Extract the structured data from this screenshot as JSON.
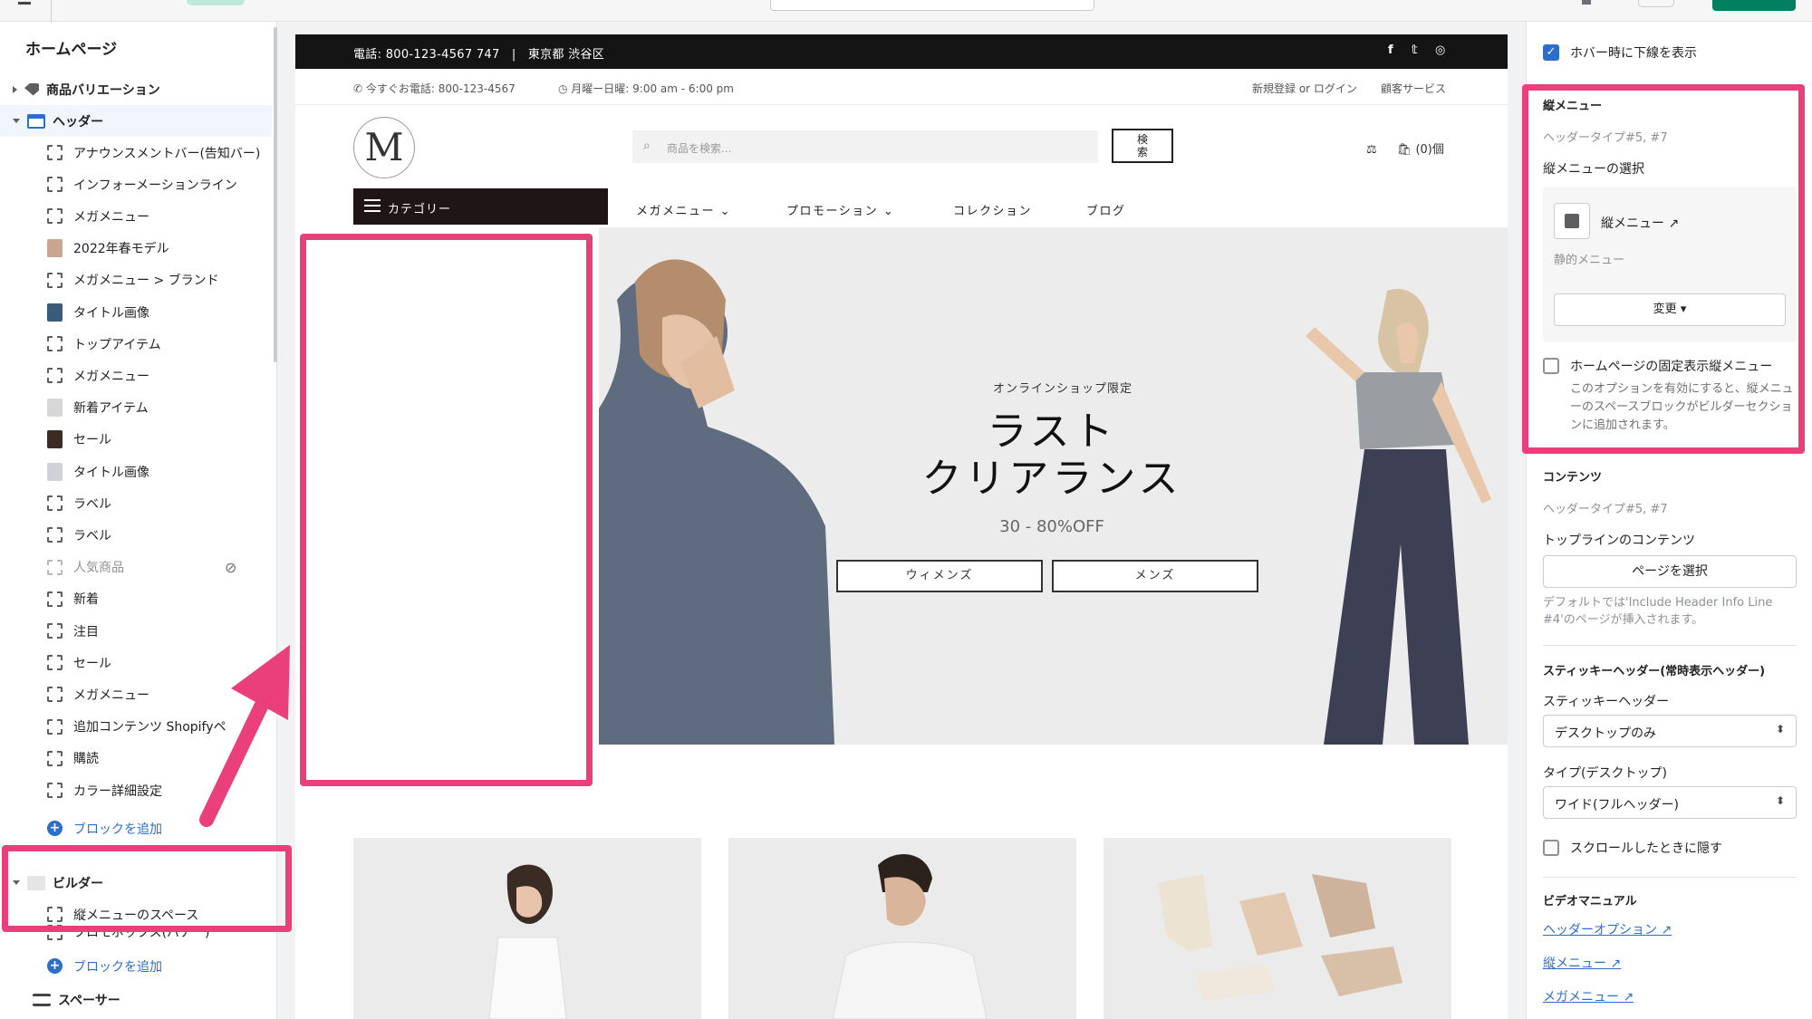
{
  "editor": {
    "page_title": "ホームページ",
    "sections": [
      {
        "label": "商品バリエーション",
        "expanded": false
      },
      {
        "label": "ヘッダー",
        "expanded": true
      },
      {
        "label": "ビルダー",
        "expanded": true
      },
      {
        "label": "スペーサー"
      }
    ],
    "header_blocks": [
      "アナウンスメントバー(告知バー)",
      "インフォーメーションライン",
      "メガメニュー",
      "2022年春モデル",
      "メガメニュー > ブランド",
      "タイトル画像",
      "トップアイテム",
      "メガメニュー",
      "新着アイテム",
      "セール",
      "タイトル画像",
      "ラベル",
      "ラベル",
      "人気商品",
      "新着",
      "注目",
      "セール",
      "メガメニュー",
      "追加コンテンツ Shopifyペ",
      "購読",
      "カラー詳細設定"
    ],
    "add_block": "ブロックを追加",
    "builder_blocks": [
      "縦メニューのスペース",
      "プロモボックス(バナー)"
    ],
    "add_block_2": "ブロックを追加"
  },
  "store": {
    "announcement": "電話: 800-123-4567 747　|　東京都 渋谷区",
    "social": [
      "f",
      "𝕥",
      "◎"
    ],
    "info_phone": "今すぐお電話: 800-123-4567",
    "info_hours": "月曜ー日曜: 9:00 am - 6:00 pm",
    "login": "新規登録 or ログイン",
    "support": "顧客サービス",
    "logo_letter": "M",
    "search_placeholder": "商品を検索...",
    "search_button": "検索",
    "cart": "(0)個",
    "category": "カテゴリー",
    "nav": [
      "メガメニュー ⌄",
      "プロモーション ⌄",
      "コレクション",
      "ブログ"
    ],
    "hero": {
      "overline": "オンラインショップ限定",
      "title_line1": "ラスト",
      "title_line2": "クリアランス",
      "subtitle": "30 - 80%OFF",
      "button_women": "ウィメンズ",
      "button_men": "メンズ"
    }
  },
  "settings": {
    "hover_underline": "ホバー時に下線を表示",
    "vmenu_heading": "縦メニュー",
    "vmenu_types": "ヘッダータイプ#5, #7",
    "vmenu_select": "縦メニューの選択",
    "vmenu_name": "縦メニュー",
    "vmenu_static": "静的メニュー",
    "change_button": "変更",
    "fixed_vmenu": "ホームページの固定表示縦メニュー",
    "fixed_note": "このオプションを有効にすると、縦メニューのスペースブロックがビルダーセクションに追加されます。",
    "content_heading": "コンテンツ",
    "content_types": "ヘッダータイプ#5, #7",
    "topline_label": "トップラインのコンテンツ",
    "select_page": "ページを選択",
    "topline_note": "デフォルトでは'Include Header Info Line #4'のページが挿入されます。",
    "sticky_heading": "スティッキーヘッダー(常時表示ヘッダー)",
    "sticky_label": "スティッキーヘッダー",
    "sticky_value": "デスクトップのみ",
    "type_label": "タイプ(デスクトップ)",
    "type_value": "ワイド(フルヘッダー)",
    "hide_scroll": "スクロールしたときに隠す",
    "video_heading": "ビデオマニュアル",
    "links": [
      "ヘッダーオプション",
      "縦メニュー",
      "メガメニュー"
    ]
  }
}
